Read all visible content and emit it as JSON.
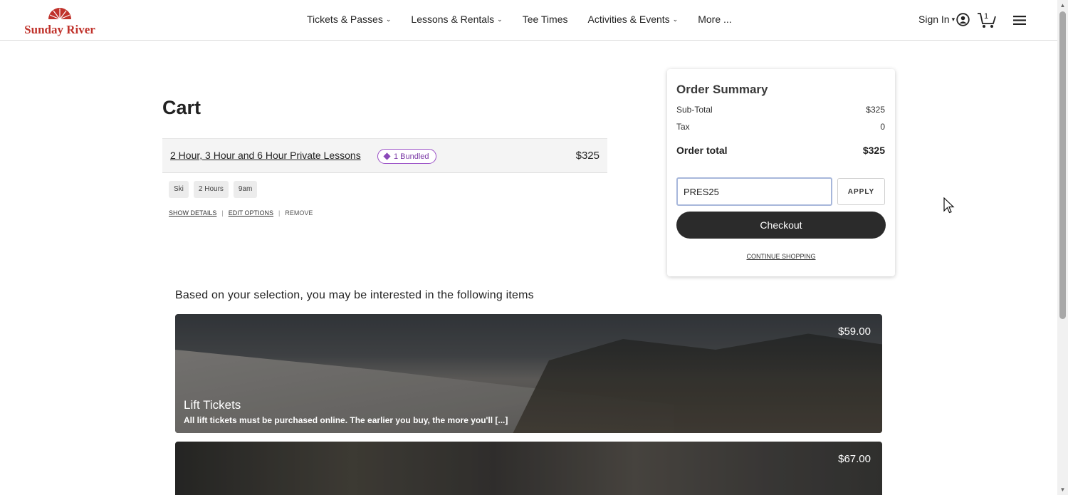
{
  "brand": {
    "name": "Sunday River",
    "color": "#c0322b"
  },
  "nav": {
    "items": [
      {
        "label": "Tickets & Passes",
        "has_dropdown": true
      },
      {
        "label": "Lessons & Rentals",
        "has_dropdown": true
      },
      {
        "label": "Tee Times",
        "has_dropdown": false
      },
      {
        "label": "Activities & Events",
        "has_dropdown": true
      },
      {
        "label": "More ...",
        "has_dropdown": false
      }
    ],
    "sign_in": "Sign In",
    "cart_count": "1",
    "icons": [
      "user-circle-icon",
      "cart-icon",
      "hamburger-menu-icon"
    ]
  },
  "cart": {
    "title": "Cart",
    "item": {
      "name": "2 Hour, 3 Hour and 6 Hour Private Lessons",
      "badge": "1 Bundled",
      "price": "$325",
      "tags": [
        "Ski",
        "2 Hours",
        "9am"
      ]
    },
    "actions": {
      "show_details": "SHOW DETAILS",
      "edit_options": "EDIT OPTIONS",
      "remove": "REMOVE"
    }
  },
  "summary": {
    "title": "Order Summary",
    "subtotal_label": "Sub-Total",
    "subtotal_value": "$325",
    "tax_label": "Tax",
    "tax_value": "0",
    "total_label": "Order total",
    "total_value": "$325",
    "promo_value": "PRES25",
    "apply_label": "APPLY",
    "checkout_label": "Checkout",
    "continue_label": "CONTINUE SHOPPING"
  },
  "recommendations": {
    "heading": "Based on your selection, you may be interested in the following items",
    "cards": [
      {
        "title": "Lift Tickets",
        "description": "All lift tickets must be purchased online. The earlier you buy, the more you'll [...]",
        "price": "$59.00"
      },
      {
        "title": "",
        "description": "",
        "price": "$67.00"
      }
    ]
  },
  "colors": {
    "accent_badge": "#9a4fc6",
    "checkout_bg": "#2b2b2b"
  }
}
